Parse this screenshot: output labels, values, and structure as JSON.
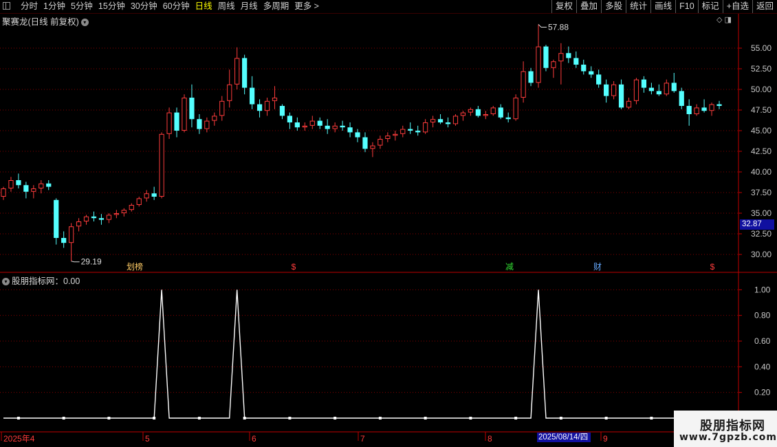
{
  "toolbar": {
    "period_tabs": [
      "分时",
      "1分钟",
      "5分钟",
      "15分钟",
      "30分钟",
      "60分钟",
      "日线",
      "周线",
      "月线",
      "多周期",
      "更多 >"
    ],
    "active_tab": "日线",
    "right_tools": [
      "复权",
      "叠加",
      "多股",
      "统计",
      "画线",
      "F10",
      "标记",
      "+自选",
      "返回"
    ]
  },
  "main_chart": {
    "title": "聚赛龙(日线 前复权)",
    "high_label": "57.88",
    "low_label": "29.19",
    "current_price": "32.87",
    "event_markers": [
      "划榜",
      "$",
      "减",
      "财",
      "$"
    ]
  },
  "indicator": {
    "title": "股朋指标网：0.00"
  },
  "time_axis": {
    "labels": [
      "2025年4",
      "5",
      "6",
      "7",
      "8",
      "9"
    ],
    "cursor_date": "2025/08/14/四"
  },
  "watermark": {
    "line1": "股朋指标网",
    "line2": "www.7gpzb.com"
  },
  "colors": {
    "up": "#ff3c3c",
    "down": "#54ffff",
    "grid": "#8a0000",
    "axis": "#c00000",
    "signal_line": "#ffffff",
    "accent_active": "#ffff00",
    "badge_bg": "#1010a0"
  },
  "chart_data": [
    {
      "type": "candlestick",
      "title": "聚赛龙(日线 前复权)",
      "ylim": [
        28,
        59
      ],
      "yticks": [
        "55.00",
        "52.50",
        "50.00",
        "47.50",
        "45.00",
        "42.50",
        "40.00",
        "37.50",
        "35.00",
        "32.50",
        "30.00"
      ],
      "period": "2025-04 to 2025-09",
      "annotations": {
        "max": 57.88,
        "min": 29.19
      },
      "ohlc": [
        [
          37.0,
          38.2,
          36.6,
          38.0
        ],
        [
          38.0,
          39.4,
          37.6,
          39.0
        ],
        [
          39.0,
          39.8,
          38.0,
          38.4
        ],
        [
          38.4,
          38.8,
          36.8,
          37.6
        ],
        [
          37.6,
          38.4,
          36.8,
          38.0
        ],
        [
          38.0,
          39.0,
          37.4,
          38.6
        ],
        [
          38.6,
          39.0,
          37.8,
          38.2
        ],
        [
          36.6,
          36.8,
          31.2,
          32.0
        ],
        [
          32.0,
          32.8,
          30.8,
          31.4
        ],
        [
          31.4,
          33.8,
          29.19,
          33.4
        ],
        [
          33.4,
          34.4,
          32.8,
          34.0
        ],
        [
          34.0,
          34.8,
          33.6,
          34.6
        ],
        [
          34.6,
          35.2,
          34.0,
          34.4
        ],
        [
          34.4,
          34.9,
          33.6,
          34.2
        ],
        [
          34.2,
          35.0,
          33.8,
          34.8
        ],
        [
          34.8,
          35.4,
          34.4,
          35.0
        ],
        [
          35.0,
          35.6,
          34.6,
          35.4
        ],
        [
          35.4,
          36.2,
          35.2,
          36.0
        ],
        [
          36.0,
          37.0,
          35.8,
          36.8
        ],
        [
          36.8,
          37.8,
          36.4,
          37.4
        ],
        [
          37.4,
          38.2,
          36.6,
          37.0
        ],
        [
          37.0,
          44.8,
          36.8,
          44.6
        ],
        [
          44.6,
          47.8,
          44.0,
          47.2
        ],
        [
          47.2,
          47.8,
          44.2,
          45.0
        ],
        [
          45.0,
          49.4,
          44.8,
          49.0
        ],
        [
          49.0,
          50.6,
          45.4,
          46.4
        ],
        [
          46.4,
          47.0,
          44.6,
          45.2
        ],
        [
          45.2,
          46.6,
          44.8,
          46.2
        ],
        [
          46.2,
          47.2,
          45.6,
          46.8
        ],
        [
          46.8,
          49.2,
          46.2,
          48.6
        ],
        [
          48.6,
          52.4,
          47.8,
          50.6
        ],
        [
          50.6,
          55.1,
          50.0,
          53.8
        ],
        [
          53.8,
          54.2,
          49.4,
          50.2
        ],
        [
          50.2,
          51.6,
          47.6,
          48.2
        ],
        [
          48.2,
          48.8,
          46.6,
          47.4
        ],
        [
          47.4,
          49.0,
          46.8,
          48.6
        ],
        [
          48.6,
          50.4,
          47.6,
          49.0
        ],
        [
          48.0,
          48.2,
          46.4,
          46.8
        ],
        [
          46.8,
          47.2,
          45.2,
          46.0
        ],
        [
          46.0,
          46.6,
          45.0,
          45.4
        ],
        [
          45.4,
          46.0,
          45.0,
          45.6
        ],
        [
          45.6,
          46.8,
          45.2,
          46.2
        ],
        [
          46.2,
          46.6,
          45.2,
          45.6
        ],
        [
          45.6,
          46.4,
          44.6,
          45.2
        ],
        [
          45.2,
          46.0,
          44.8,
          45.6
        ],
        [
          45.6,
          46.2,
          45.0,
          45.4
        ],
        [
          45.4,
          46.0,
          44.2,
          44.8
        ],
        [
          44.8,
          45.2,
          43.6,
          44.2
        ],
        [
          44.2,
          44.8,
          42.4,
          42.8
        ],
        [
          42.8,
          43.6,
          41.8,
          43.2
        ],
        [
          43.2,
          44.4,
          42.8,
          44.0
        ],
        [
          44.0,
          44.8,
          43.6,
          44.4
        ],
        [
          44.4,
          45.0,
          43.8,
          44.6
        ],
        [
          44.6,
          45.6,
          44.2,
          45.2
        ],
        [
          45.2,
          46.0,
          44.6,
          45.0
        ],
        [
          45.0,
          45.6,
          44.4,
          44.8
        ],
        [
          44.8,
          46.4,
          44.6,
          46.0
        ],
        [
          46.0,
          46.8,
          45.4,
          46.4
        ],
        [
          46.4,
          47.0,
          45.8,
          46.0
        ],
        [
          46.0,
          46.6,
          45.4,
          45.8
        ],
        [
          45.8,
          47.0,
          45.6,
          46.8
        ],
        [
          46.8,
          47.4,
          46.2,
          47.2
        ],
        [
          47.2,
          47.8,
          46.8,
          47.6
        ],
        [
          47.6,
          48.0,
          46.6,
          46.8
        ],
        [
          46.8,
          47.4,
          46.4,
          47.0
        ],
        [
          47.0,
          48.0,
          46.8,
          47.8
        ],
        [
          47.8,
          48.2,
          46.4,
          46.6
        ],
        [
          46.6,
          47.2,
          46.0,
          46.4
        ],
        [
          46.4,
          49.4,
          46.2,
          49.0
        ],
        [
          49.0,
          53.4,
          48.4,
          52.2
        ],
        [
          52.2,
          52.6,
          50.4,
          50.8
        ],
        [
          50.8,
          57.88,
          50.2,
          55.2
        ],
        [
          55.2,
          55.4,
          52.2,
          52.6
        ],
        [
          52.6,
          53.6,
          51.4,
          53.4
        ],
        [
          53.4,
          55.6,
          50.6,
          54.4
        ],
        [
          54.4,
          55.2,
          53.2,
          53.8
        ],
        [
          53.8,
          54.6,
          52.6,
          53.0
        ],
        [
          53.0,
          53.6,
          51.8,
          52.2
        ],
        [
          52.2,
          52.8,
          51.4,
          51.8
        ],
        [
          51.8,
          52.4,
          50.2,
          50.6
        ],
        [
          50.6,
          51.2,
          48.4,
          49.2
        ],
        [
          49.2,
          51.0,
          48.8,
          50.6
        ],
        [
          50.6,
          51.2,
          47.6,
          47.8
        ],
        [
          47.8,
          49.0,
          47.6,
          48.6
        ],
        [
          48.6,
          51.4,
          48.2,
          51.2
        ],
        [
          51.2,
          51.6,
          49.6,
          50.2
        ],
        [
          50.2,
          50.8,
          49.4,
          49.8
        ],
        [
          49.8,
          50.6,
          49.2,
          49.4
        ],
        [
          49.4,
          51.2,
          49.2,
          50.8
        ],
        [
          50.8,
          52.0,
          49.6,
          49.8
        ],
        [
          49.8,
          50.2,
          47.6,
          48.0
        ],
        [
          48.0,
          48.8,
          45.6,
          47.0
        ],
        [
          47.0,
          48.2,
          46.8,
          47.8
        ],
        [
          47.8,
          48.8,
          47.2,
          47.4
        ],
        [
          47.4,
          48.4,
          46.8,
          48.2
        ],
        [
          48.2,
          48.6,
          47.6,
          48.0
        ]
      ]
    },
    {
      "type": "line",
      "title": "股朋指标网：0.00",
      "ylim": [
        0,
        1.05
      ],
      "yticks": [
        "1.00",
        "0.80",
        "0.60",
        "0.40",
        "0.20"
      ],
      "signal_bars": [
        21,
        31,
        71
      ],
      "signal_value": 1.0,
      "baseline_value": 0.0
    }
  ]
}
